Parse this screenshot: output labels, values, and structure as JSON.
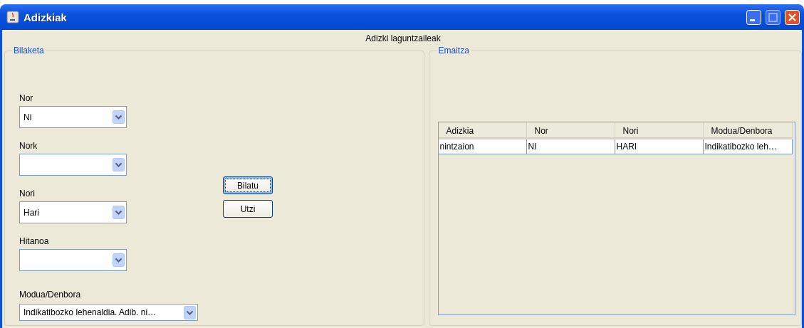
{
  "window": {
    "title": "Adizkiak"
  },
  "subtitle": "Adizki laguntzaileak",
  "search": {
    "title": "Bilaketa",
    "fields": [
      {
        "label": "Nor",
        "value": "Ni",
        "kind": "normal"
      },
      {
        "label": "Nork",
        "kind": "normal"
      },
      {
        "label": "Nori",
        "value": "Hari",
        "kind": "normal"
      },
      {
        "label": "Hitanoa",
        "kind": "normal"
      },
      {
        "label": "Modua/Denbora",
        "value": "Indikatibozko lehenaldia. Adib. ni…",
        "kind": "wide"
      }
    ],
    "buttons": [
      {
        "label": "Bilatu",
        "focused": true
      },
      {
        "label": "Utzi",
        "focused": false
      }
    ]
  },
  "result": {
    "title": "Emaitza",
    "table": {
      "columns": [
        "Adizkia",
        "Nor",
        "Nori",
        "Modua/Denbora"
      ],
      "rows": [
        [
          "nintzaion",
          "NI",
          "HARI",
          "Indikatibozko leh…"
        ]
      ]
    }
  }
}
